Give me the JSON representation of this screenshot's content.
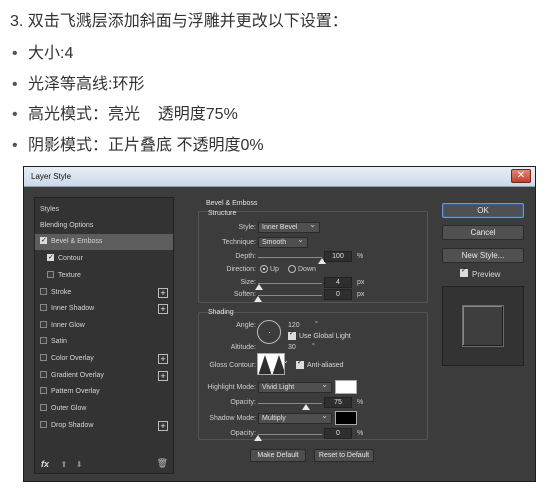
{
  "article": {
    "heading": "3. 双击飞溅层添加斜面与浮雕并更改以下设置：",
    "bullets": [
      "大小:4",
      "光泽等高线:环形",
      "高光模式：亮光    透明度75%",
      "阴影模式：正片叠底 不透明度0%"
    ],
    "bullet_char": "•"
  },
  "dialog": {
    "title": "Layer Style",
    "close_glyph": "✕",
    "styles_panel": {
      "items": [
        {
          "label": "Styles",
          "checkbox": false,
          "checked": false,
          "plus": false,
          "selected": false,
          "indent": 0
        },
        {
          "label": "Blending Options",
          "checkbox": false,
          "checked": false,
          "plus": false,
          "selected": false,
          "indent": 0
        },
        {
          "label": "Bevel & Emboss",
          "checkbox": true,
          "checked": true,
          "plus": false,
          "selected": true,
          "indent": 0
        },
        {
          "label": "Contour",
          "checkbox": true,
          "checked": true,
          "plus": false,
          "selected": false,
          "indent": 1
        },
        {
          "label": "Texture",
          "checkbox": true,
          "checked": false,
          "plus": false,
          "selected": false,
          "indent": 1
        },
        {
          "label": "Stroke",
          "checkbox": true,
          "checked": false,
          "plus": true,
          "selected": false,
          "indent": 0
        },
        {
          "label": "Inner Shadow",
          "checkbox": true,
          "checked": false,
          "plus": true,
          "selected": false,
          "indent": 0
        },
        {
          "label": "Inner Glow",
          "checkbox": true,
          "checked": false,
          "plus": false,
          "selected": false,
          "indent": 0
        },
        {
          "label": "Satin",
          "checkbox": true,
          "checked": false,
          "plus": false,
          "selected": false,
          "indent": 0
        },
        {
          "label": "Color Overlay",
          "checkbox": true,
          "checked": false,
          "plus": true,
          "selected": false,
          "indent": 0
        },
        {
          "label": "Gradient Overlay",
          "checkbox": true,
          "checked": false,
          "plus": true,
          "selected": false,
          "indent": 0
        },
        {
          "label": "Pattern Overlay",
          "checkbox": true,
          "checked": false,
          "plus": false,
          "selected": false,
          "indent": 0
        },
        {
          "label": "Outer Glow",
          "checkbox": true,
          "checked": false,
          "plus": false,
          "selected": false,
          "indent": 0
        },
        {
          "label": "Drop Shadow",
          "checkbox": true,
          "checked": false,
          "plus": true,
          "selected": false,
          "indent": 0
        }
      ],
      "fx_label": "fx",
      "up_glyph": "⬆",
      "down_glyph": "⬇",
      "trash_glyph": "🗑"
    },
    "bevel_emboss": {
      "title": "Bevel & Emboss",
      "structure": {
        "title": "Structure",
        "style_label": "Style:",
        "style_value": "Inner Bevel",
        "technique_label": "Technique:",
        "technique_value": "Smooth",
        "depth_label": "Depth:",
        "depth_value": "100",
        "depth_unit": "%",
        "depth_level": 1.0,
        "direction_label": "Direction:",
        "direction_up": "Up",
        "direction_down": "Down",
        "direction_selected": "Up",
        "size_label": "Size:",
        "size_value": "4",
        "size_unit": "px",
        "size_level": 0.02,
        "soften_label": "Soften:",
        "soften_value": "0",
        "soften_unit": "px",
        "soften_level": 0.0
      },
      "shading": {
        "title": "Shading",
        "angle_label": "Angle:",
        "angle_value": "120",
        "angle_unit": "°",
        "use_global_light_label": "Use Global Light",
        "use_global_light": true,
        "altitude_label": "Altitude:",
        "altitude_value": "30",
        "altitude_unit": "°",
        "gloss_contour_label": "Gloss Contour:",
        "anti_aliased_label": "Anti-aliased",
        "anti_aliased": true,
        "highlight_mode_label": "Highlight Mode:",
        "highlight_mode_value": "Vivid Light",
        "highlight_color": "#ffffff",
        "highlight_opacity_label": "Opacity:",
        "highlight_opacity_value": "75",
        "highlight_opacity_unit": "%",
        "highlight_opacity_level": 0.75,
        "shadow_mode_label": "Shadow Mode:",
        "shadow_mode_value": "Multiply",
        "shadow_color": "#000000",
        "shadow_opacity_label": "Opacity:",
        "shadow_opacity_value": "0",
        "shadow_opacity_unit": "%",
        "shadow_opacity_level": 0.0
      },
      "make_default_label": "Make Default",
      "reset_default_label": "Reset to Default"
    },
    "right": {
      "ok_label": "OK",
      "cancel_label": "Cancel",
      "new_style_label": "New Style...",
      "preview_label": "Preview",
      "preview_checked": true
    }
  }
}
